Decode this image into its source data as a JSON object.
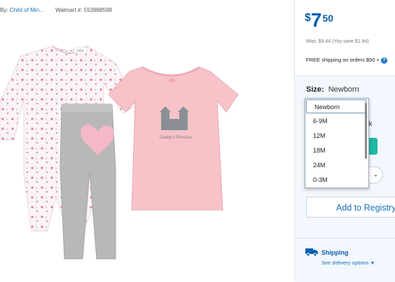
{
  "byline": {
    "prefix": "By:",
    "brand_link": "Child of Min...",
    "walmart_label": "Walmart #:",
    "walmart_number": "553988598"
  },
  "product": {
    "icons": [
      "bodysuit-image",
      "pants-image",
      "tshirt-image"
    ],
    "tshirt_print": "Daddy's Princess",
    "bodysuit_label": "child"
  },
  "price": {
    "currency": "$",
    "dollars": "7",
    "cents": "50",
    "was": "Was: $9.44  (You save $1.94)",
    "free_shipping": "FREE shipping on orders $50 +"
  },
  "size": {
    "label": "Size:",
    "selected": "Newborn",
    "options": [
      "Newborn",
      "6-9M",
      "12M",
      "18M",
      "24M",
      "0-3M"
    ]
  },
  "obscured_text": "nk",
  "registry_button": "Add to Registry",
  "shipping": {
    "title": "Shipping",
    "link": "See delivery options"
  },
  "colors": {
    "accent_blue": "#0b5fae",
    "teal_button": "#1eb8a6",
    "panel_bg": "#f2f8fd"
  }
}
